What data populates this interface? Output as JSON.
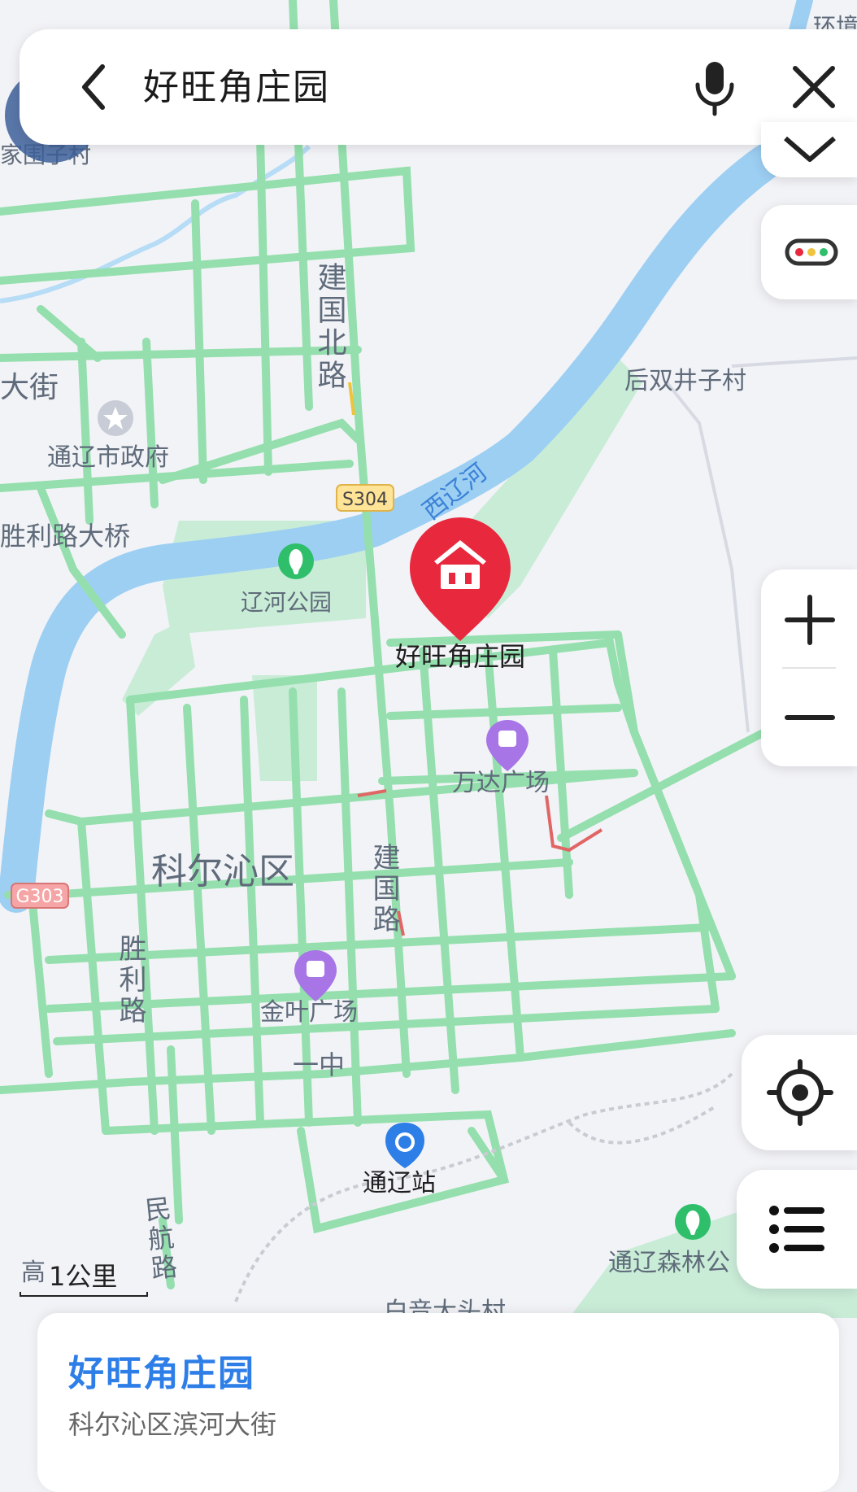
{
  "search": {
    "query": "好旺角庄园"
  },
  "map": {
    "pin_label": "好旺角庄园",
    "district": "科尔沁区",
    "roads": {
      "jianguo_north": "建国北路",
      "jianguo": "建国路",
      "shengli": "胜利路",
      "minhang": "民航路",
      "dajie": "大街",
      "shengli_bridge": "胜利路大桥",
      "yizhong": "一中",
      "s304": "S304",
      "g303": "G303"
    },
    "river": "西辽河",
    "places": {
      "tongliao_gov": "通辽市政府",
      "liaohe_park": "辽河公园",
      "wanda": "万达广场",
      "jinye": "金叶广场",
      "station": "通辽站",
      "forest": "通辽森林公",
      "houshuang": "后双井子村",
      "village_top": "家围子村",
      "village_bottom": "白音大头村",
      "gao": "高",
      "huanjing": "环境"
    }
  },
  "scale": {
    "label": "1公里"
  },
  "result": {
    "title": "好旺角庄园",
    "address": "科尔沁区滨河大街"
  },
  "colors": {
    "road": "#8fe0a8",
    "water": "#9cd0f5",
    "park": "#a9e2bf",
    "pin": "#e8283d",
    "accent": "#2e7ee8"
  },
  "icons": [
    "back-icon",
    "mic-icon",
    "close-icon",
    "layers-icon",
    "traffic-icon",
    "zoom-in-icon",
    "zoom-out-icon",
    "locate-icon",
    "list-icon"
  ]
}
